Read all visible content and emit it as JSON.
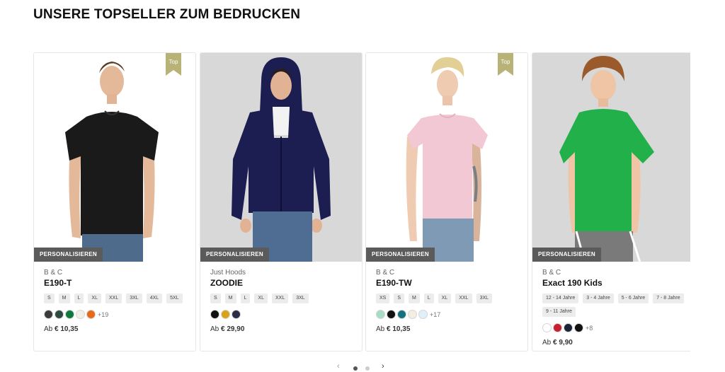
{
  "section": {
    "title": "UNSERE TOPSELLER ZUM BEDRUCKEN"
  },
  "badge_label": "PERSONALISIEREN",
  "top_label": "Top",
  "price_prefix": "Ab",
  "products": [
    {
      "brand": "B & C",
      "name": "E190-T",
      "sizes": [
        "S",
        "M",
        "L",
        "XL",
        "XXL",
        "3XL",
        "4XL",
        "5XL"
      ],
      "swatches": [
        "#3b3b3b",
        "#2f4a3f",
        "#0d7a3b",
        "#f1efe6",
        "#e8691a"
      ],
      "more_colors": "+19",
      "price": "€ 10,35",
      "top": true
    },
    {
      "brand": "Just Hoods",
      "name": "ZOODIE",
      "sizes": [
        "S",
        "M",
        "L",
        "XL",
        "XXL",
        "3XL"
      ],
      "swatches": [
        "#111111",
        "#d9a21b",
        "#2b2e44"
      ],
      "more_colors": "",
      "price": "€ 29,90",
      "top": false
    },
    {
      "brand": "B & C",
      "name": "E190-TW",
      "sizes": [
        "XS",
        "S",
        "M",
        "L",
        "XL",
        "XXL",
        "3XL"
      ],
      "swatches": [
        "#a8dcc5",
        "#111111",
        "#14737c",
        "#f4ede1",
        "#dff0fb"
      ],
      "more_colors": "+17",
      "price": "€ 10,35",
      "top": true
    },
    {
      "brand": "B & C",
      "name": "Exact 190 Kids",
      "sizes": [
        "12 - 14 Jahre",
        "3 - 4 Jahre",
        "5 - 6 Jahre",
        "7 - 8 Jahre",
        "9 - 11 Jahre"
      ],
      "swatches": [
        "#ffffff",
        "#c62031",
        "#1e2436",
        "#111111"
      ],
      "more_colors": "+8",
      "price": "€ 9,90",
      "top": false
    }
  ],
  "colors": {
    "top_flag": "#b8b277",
    "badge_bg": "#5b5b5b",
    "tee_black": "#1a1a1a",
    "hoodie_navy": "#1c1d50",
    "tee_pink": "#f2c8d4",
    "tee_green": "#22b04b"
  }
}
